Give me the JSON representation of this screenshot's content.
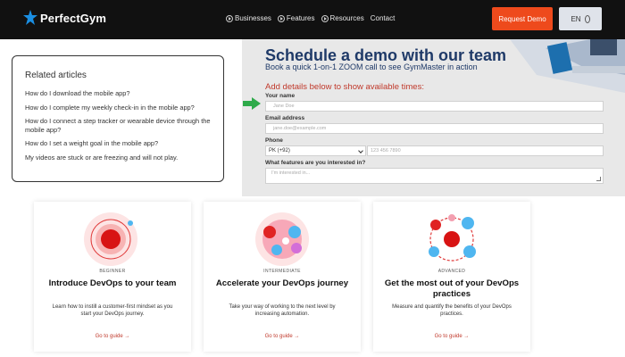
{
  "header": {
    "brand": "PerfectGym",
    "nav": [
      {
        "label": "Businesses"
      },
      {
        "label": "Features"
      },
      {
        "label": "Resources"
      },
      {
        "label": "Contact"
      }
    ],
    "cta_label": "Request Demo",
    "language": "EN",
    "colors": {
      "bar": "#111111",
      "cta": "#ee4a1c",
      "brand_mark": "#1a8fe3"
    }
  },
  "related": {
    "title": "Related articles",
    "links": [
      "How do I download the mobile app?",
      "How do I complete my weekly check-in in the mobile app?",
      "How do I connect a step tracker or wearable device through the mobile app?",
      "How do I set a weight goal in the mobile app?",
      "My videos are stuck or are freezing and will not play."
    ]
  },
  "schedule": {
    "title": "Schedule a demo with our team",
    "subtitle": "Book a quick 1-on-1 ZOOM call to see GymMaster in action",
    "instruction": "Add details below to show available times:",
    "name_label": "Your name",
    "name_placeholder": "Jane Doe",
    "email_label": "Email address",
    "email_placeholder": "jane.doe@example.com",
    "phone_label": "Phone",
    "country_code": "PK (+92)",
    "phone_placeholder": "123 456 7890",
    "features_label": "What features are you interested in?",
    "features_placeholder": "I'm interested in...",
    "colors": {
      "title": "#1f3a68",
      "instruction": "#c0392b",
      "arrow": "#2eaa4a"
    }
  },
  "cards": [
    {
      "level": "BEGINNER",
      "title": "Introduce DevOps to your team",
      "desc": "Learn how to instill a customer-first mindset as you start your DevOps journey.",
      "link": "Go to guide →"
    },
    {
      "level": "INTERMEDIATE",
      "title": "Accelerate your DevOps journey",
      "desc": "Take your way of working to the next level by increasing automation.",
      "link": "Go to guide →"
    },
    {
      "level": "ADVANCED",
      "title": "Get the most out of your DevOps practices",
      "desc": "Measure and quantify the benefits of your DevOps practices.",
      "link": "Go to guide →"
    }
  ]
}
